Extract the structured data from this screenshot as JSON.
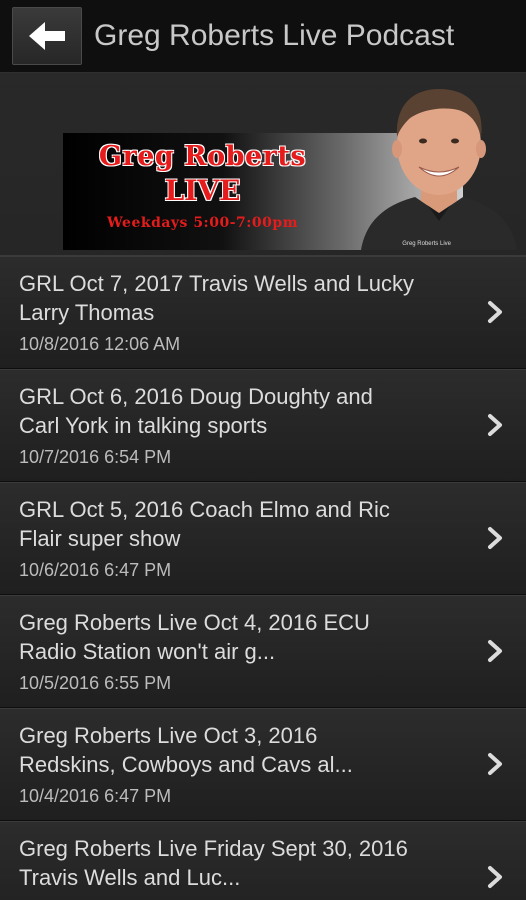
{
  "header": {
    "title": "Greg Roberts Live Podcast",
    "back_icon": "back-arrow-icon"
  },
  "banner": {
    "name": "Greg Roberts",
    "live": "LIVE",
    "hours": "Weekdays 5:00-7:00pm",
    "credit": "Greg Roberts Live"
  },
  "episodes": [
    {
      "title_line1": "GRL Oct 7, 2017 Travis Wells and Lucky",
      "title_line2": "Larry Thomas",
      "date": "10/8/2016 12:06 AM"
    },
    {
      "title_line1": "GRL Oct 6, 2016 Doug Doughty and",
      "title_line2": "Carl York in talking sports",
      "date": "10/7/2016 6:54 PM"
    },
    {
      "title_line1": "GRL Oct 5, 2016 Coach Elmo and Ric",
      "title_line2": "Flair super show",
      "date": "10/6/2016 6:47 PM"
    },
    {
      "title_line1": "Greg Roberts Live Oct 4, 2016 ECU",
      "title_line2": "Radio Station won't air g...",
      "date": "10/5/2016 6:55 PM"
    },
    {
      "title_line1": "Greg Roberts Live Oct 3, 2016",
      "title_line2": "Redskins, Cowboys and Cavs al...",
      "date": "10/4/2016 6:47 PM"
    },
    {
      "title_line1": "Greg Roberts Live Friday Sept 30, 2016",
      "title_line2": "Travis Wells and Luc...",
      "date": ""
    }
  ],
  "colors": {
    "accent_red": "#e61c1c",
    "topbar": "#0f0f0f",
    "row_text": "#dcdcdc"
  }
}
